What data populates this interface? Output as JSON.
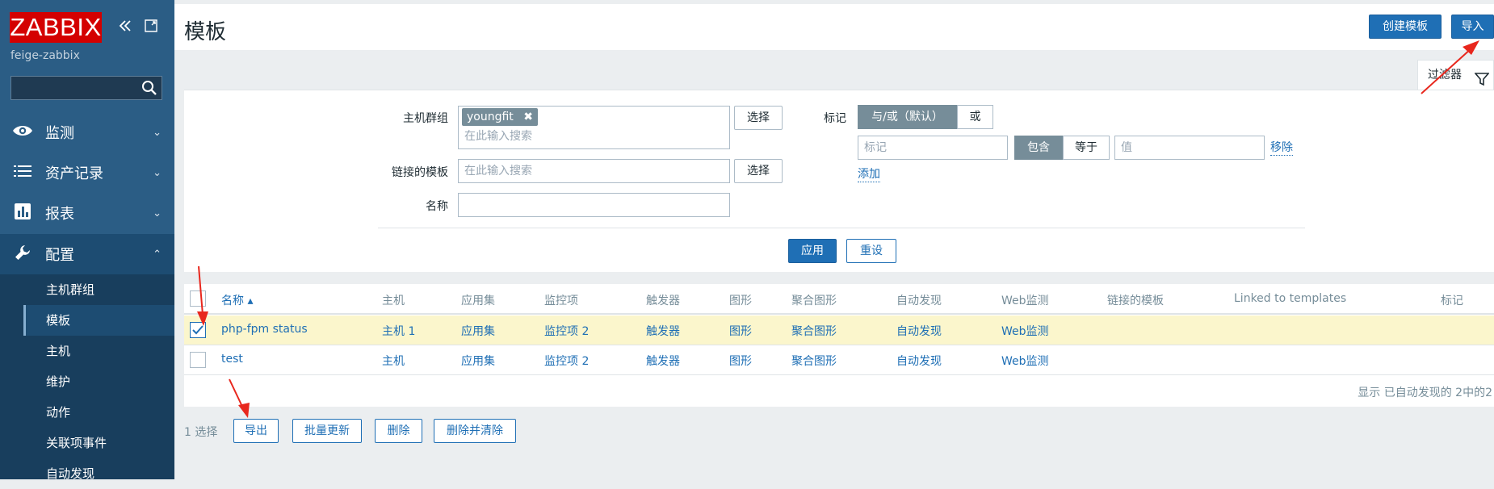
{
  "sidebar": {
    "logo": "ZABBIX",
    "server_name": "feige-zabbix",
    "search_value": "",
    "menu": [
      {
        "label": "监测",
        "icon": "eye-icon"
      },
      {
        "label": "资产记录",
        "icon": "list-icon"
      },
      {
        "label": "报表",
        "icon": "bar-chart-icon"
      },
      {
        "label": "配置",
        "icon": "wrench-icon"
      }
    ],
    "submenu": [
      {
        "label": "主机群组"
      },
      {
        "label": "模板"
      },
      {
        "label": "主机"
      },
      {
        "label": "维护"
      },
      {
        "label": "动作"
      },
      {
        "label": "关联项事件"
      },
      {
        "label": "自动发现"
      }
    ]
  },
  "header": {
    "title": "模板",
    "create_button": "创建模板",
    "import_button": "导入"
  },
  "filter": {
    "tab_label": "过滤器",
    "host_group_label": "主机群组",
    "host_group_chip": "youngfit",
    "search_placeholder": "在此输入搜索",
    "select_button": "选择",
    "linked_template_label": "链接的模板",
    "name_label": "名称",
    "name_value": "",
    "tag_label": "标记",
    "andor_default": "与/或（默认）",
    "or_label": "或",
    "tag_placeholder": "标记",
    "contains": "包含",
    "equals": "等于",
    "value_placeholder": "值",
    "remove": "移除",
    "add": "添加",
    "apply": "应用",
    "reset": "重设"
  },
  "table": {
    "headers": {
      "name": "名称 ▴",
      "hosts": "主机",
      "apps": "应用集",
      "items": "监控项",
      "triggers": "触发器",
      "graphs": "图形",
      "screens": "聚合图形",
      "discovery": "自动发现",
      "web": "Web监测",
      "linked": "链接的模板",
      "linked_to": "Linked to templates",
      "tags": "标记"
    },
    "rows": [
      {
        "name": "php-fpm status",
        "hosts": "主机 1",
        "apps": "应用集",
        "items": "监控项 2",
        "triggers": "触发器",
        "graphs": "图形",
        "screens": "聚合图形",
        "discovery": "自动发现",
        "web": "Web监测",
        "checked": true
      },
      {
        "name": "test",
        "hosts": "主机",
        "apps": "应用集",
        "items": "监控项 2",
        "triggers": "触发器",
        "graphs": "图形",
        "screens": "聚合图形",
        "discovery": "自动发现",
        "web": "Web监测",
        "checked": false
      }
    ],
    "footer": "显示 已自动发现的 2中的2"
  },
  "actions": {
    "selected_count": "1 选择",
    "export": "导出",
    "mass_update": "批量更新",
    "delete": "删除",
    "delete_clear": "删除并清除"
  },
  "colors": {
    "sidebar": "#2b5d85",
    "logo": "#d40000",
    "primary": "#1f6fb5",
    "selected_row": "#fbf6cc",
    "annotation_arrow": "#e8271d"
  }
}
